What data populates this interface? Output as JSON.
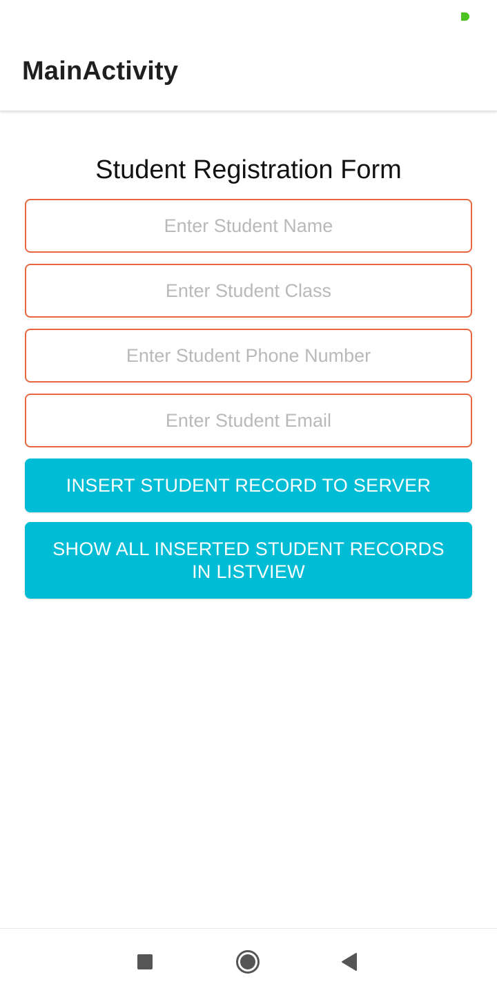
{
  "app_bar": {
    "title": "MainActivity"
  },
  "form": {
    "title": "Student Registration Form",
    "fields": [
      {
        "placeholder": "Enter Student Name",
        "value": ""
      },
      {
        "placeholder": "Enter Student Class",
        "value": ""
      },
      {
        "placeholder": "Enter Student Phone Number",
        "value": ""
      },
      {
        "placeholder": "Enter Student Email",
        "value": ""
      }
    ],
    "insert_button_label": "INSERT STUDENT RECORD TO SERVER",
    "show_button_label": "SHOW ALL INSERTED STUDENT RECORDS IN LISTVIEW"
  },
  "nav_bar": {
    "icons": [
      "recents-icon",
      "home-icon",
      "back-icon"
    ]
  },
  "colors": {
    "field_border": "#e8663d",
    "button_bg": "#00bcd4",
    "status_dot": "#4cc21f"
  }
}
